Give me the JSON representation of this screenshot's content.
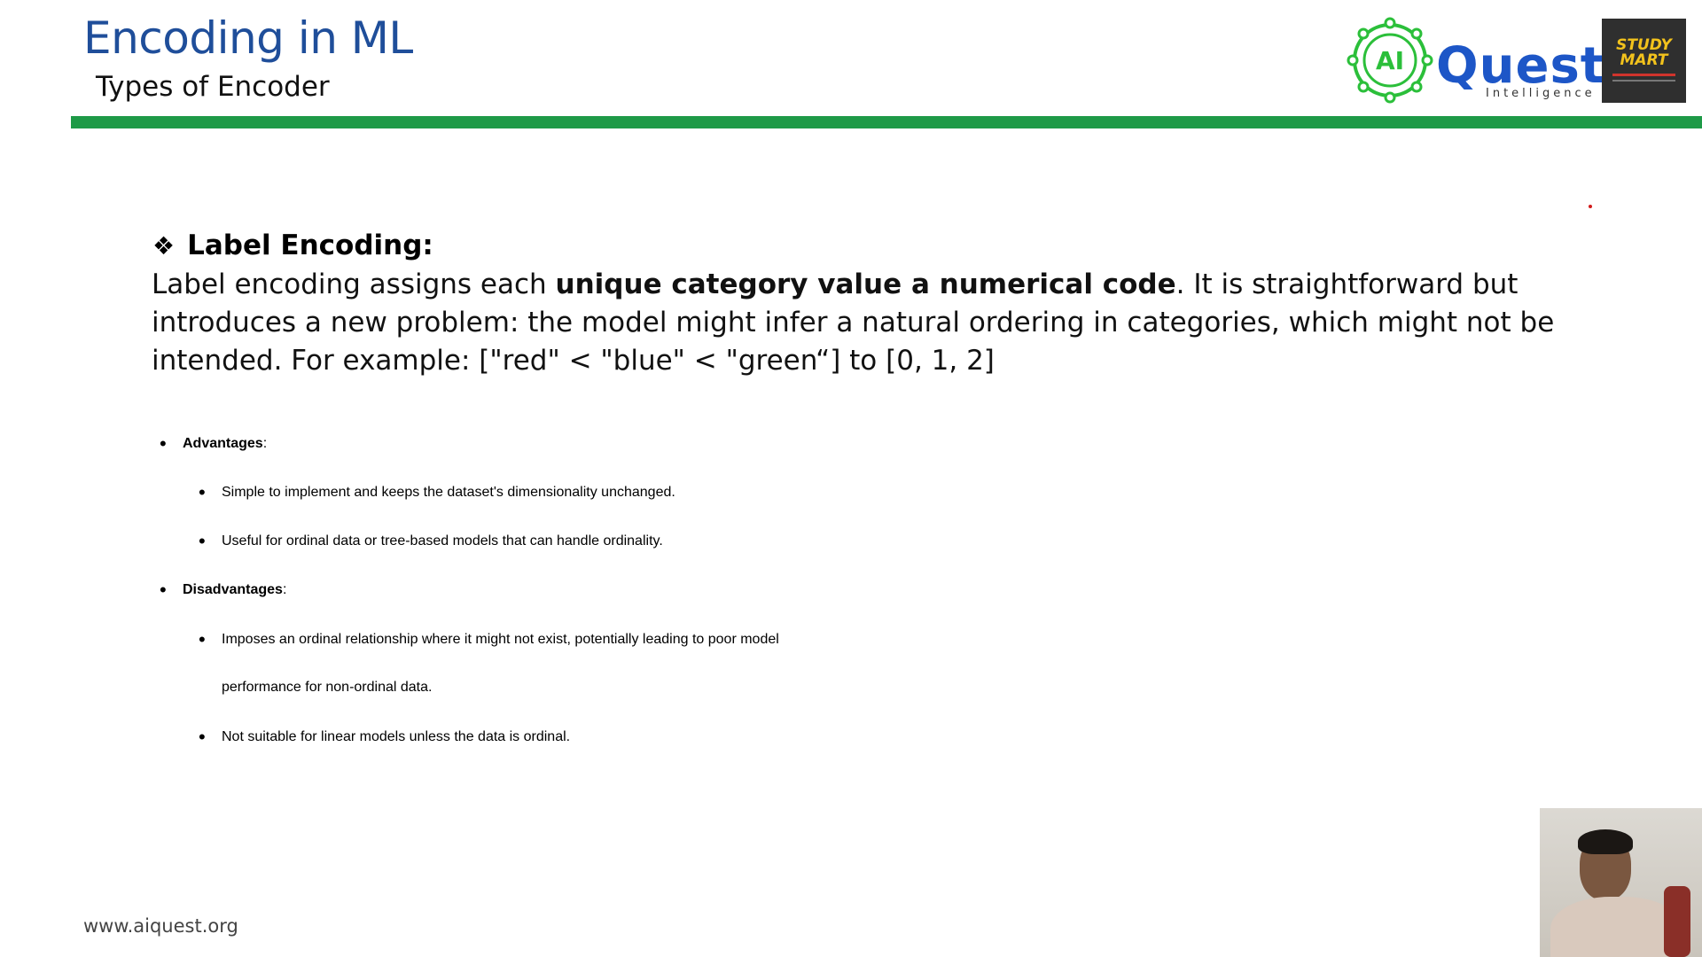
{
  "header": {
    "title": "Encoding in ML",
    "subtitle": "Types of Encoder",
    "rule_color": "#1e9a47",
    "title_color": "#1f4e9a"
  },
  "logos": {
    "quest": {
      "badge": "AI",
      "word": "Quest",
      "tagline": "Intelligence",
      "color": "#1d56c7",
      "ring_color": "#2bbf3a"
    },
    "study_mart": {
      "line1": "STUDY",
      "line2": "MART",
      "bg": "#2f2f2f",
      "text_color": "#f2c21c"
    }
  },
  "content": {
    "heading_icon": "diamond-bullet-icon",
    "heading": "Label Encoding:",
    "para_start": "Label encoding assigns each ",
    "para_bold": "unique category value a numerical code",
    "para_end": ". It is straightforward but introduces a new problem: the model might infer a natural ordering in categories, which might not be intended. For example: [\"red\" < \"blue\" < \"green“] to [0, 1, 2]",
    "advantages": {
      "label": "Advantages",
      "suffix": ":",
      "items": [
        "Simple to implement and keeps the dataset's dimensionality unchanged.",
        "Useful for ordinal data or tree-based models that can handle ordinality."
      ]
    },
    "disadvantages": {
      "label": "Disadvantages",
      "suffix": ":",
      "items": [
        "Imposes an ordinal relationship where it might not exist, potentially leading to poor model",
        "performance for non-ordinal data.",
        "Not suitable for linear models unless the data is ordinal."
      ]
    }
  },
  "footer": {
    "url": "www.aiquest.org"
  }
}
